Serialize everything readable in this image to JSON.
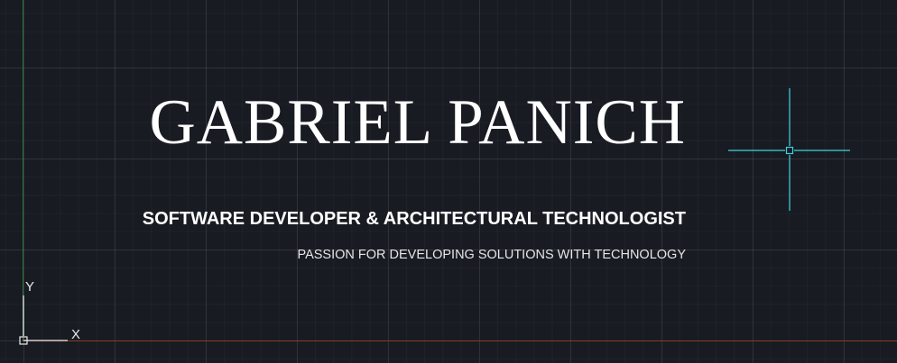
{
  "header": {
    "name": "GABRIEL PANICH",
    "role": "SOFTWARE DEVELOPER & ARCHITECTURAL TECHNOLOGIST",
    "tagline": "PASSION FOR DEVELOPING SOLUTIONS WITH TECHNOLOGY"
  },
  "ucs_icon": {
    "y_label": "Y",
    "x_label": "X"
  },
  "colors": {
    "background": "#181b22",
    "grid": "#2a2e36",
    "crosshair": "#3fd3e0",
    "axis_y": "#2f7a3a",
    "axis_x": "#8a3a2a",
    "text": "#ffffff"
  },
  "icons": [
    "crosshair-cursor-icon",
    "ucs-axis-icon"
  ]
}
